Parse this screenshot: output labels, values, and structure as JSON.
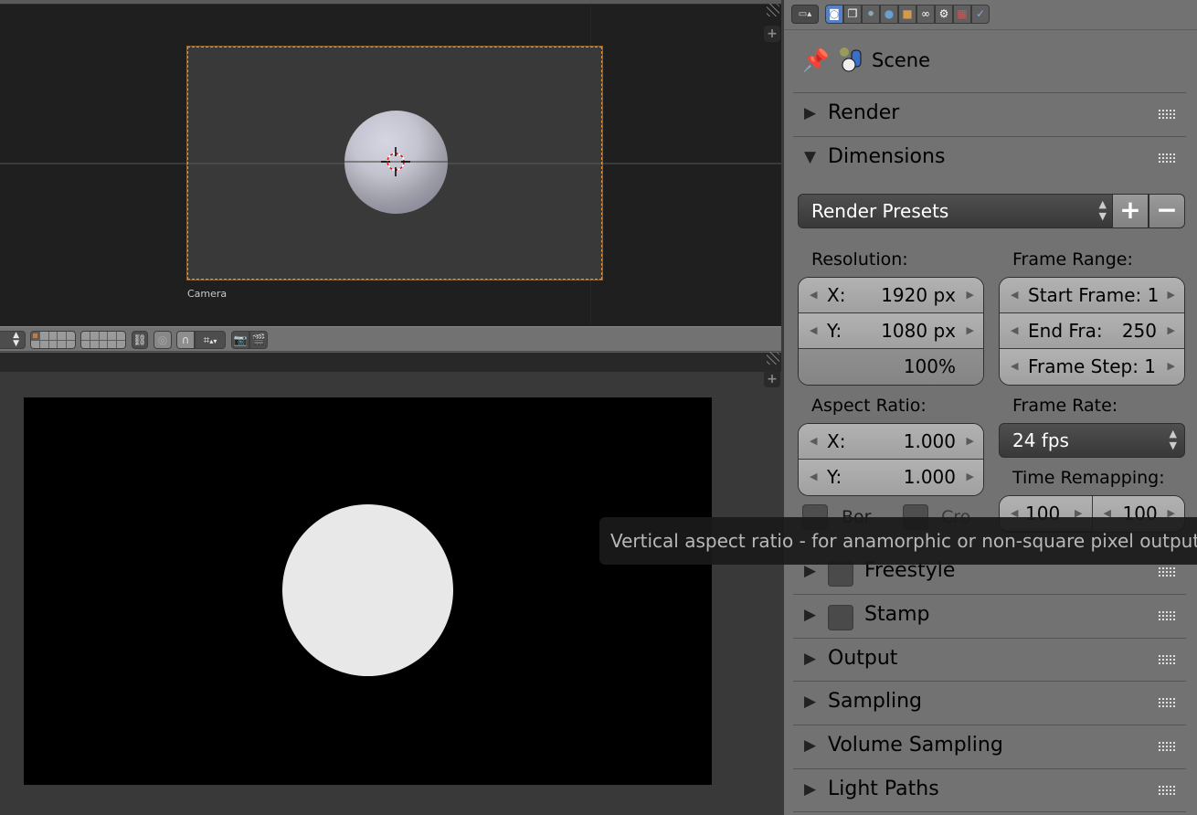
{
  "viewport3d": {
    "camera_label": "Camera",
    "object": "sphere"
  },
  "toolbar3d": {
    "items": [
      {
        "name": "mode-selector",
        "icon": "up-down-arrows"
      },
      {
        "name": "layers-group-1",
        "icon": "layer-grid"
      },
      {
        "name": "layers-group-2",
        "icon": "layer-grid"
      },
      {
        "name": "lock-camera-to-view",
        "icon": "chain-link-icon"
      },
      {
        "name": "proportional-editing",
        "icon": "circle-icon"
      },
      {
        "name": "snap-toggle",
        "icon": "magnet-icon"
      },
      {
        "name": "snap-element",
        "icon": "grid-snap-icon"
      },
      {
        "name": "render-still",
        "icon": "camera-icon"
      },
      {
        "name": "render-animation",
        "icon": "clapper-icon"
      }
    ]
  },
  "properties": {
    "context_tabs": [
      {
        "name": "render",
        "icon": "camera-icon",
        "active": true
      },
      {
        "name": "render-layers",
        "icon": "layers-icon",
        "active": false
      },
      {
        "name": "scene",
        "icon": "scene-icon",
        "active": false
      },
      {
        "name": "world",
        "icon": "globe-icon",
        "active": false
      },
      {
        "name": "object",
        "icon": "cube-icon",
        "active": false
      },
      {
        "name": "constraints",
        "icon": "link-icon",
        "active": false
      },
      {
        "name": "modifiers",
        "icon": "wrench-icon",
        "active": false
      },
      {
        "name": "texture",
        "icon": "checker-icon",
        "active": false
      },
      {
        "name": "particles",
        "icon": "particle-icon",
        "active": false
      }
    ],
    "context_label": "Scene",
    "panels_top": [
      {
        "label": "Render",
        "expanded": false
      },
      {
        "label": "Dimensions",
        "expanded": true
      }
    ],
    "dimensions": {
      "presets_label": "Render Presets",
      "add_symbol": "+",
      "remove_symbol": "−",
      "resolution_label": "Resolution:",
      "res_x_key": "X:",
      "res_x_val": "1920 px",
      "res_y_key": "Y:",
      "res_y_val": "1080 px",
      "res_percent": "100%",
      "frame_range_label": "Frame Range:",
      "start_frame": "Start Frame: 1",
      "end_frame_key": "End Fra:",
      "end_frame_val": "250",
      "frame_step": "Frame Step: 1",
      "aspect_label": "Aspect Ratio:",
      "aspect_x_key": "X:",
      "aspect_x_val": "1.000",
      "aspect_y_key": "Y:",
      "aspect_y_val": "1.000",
      "frame_rate_label": "Frame Rate:",
      "frame_rate_value": "24 fps",
      "time_remap_label": "Time Remapping:",
      "time_remap_old": "100",
      "time_remap_new": "100",
      "border_label": "Bor",
      "crop_label": "Cro"
    },
    "panels_bottom": [
      {
        "label": "Freestyle",
        "checkbox": true
      },
      {
        "label": "Stamp",
        "checkbox": true
      },
      {
        "label": "Output",
        "checkbox": false
      },
      {
        "label": "Sampling",
        "checkbox": false
      },
      {
        "label": "Volume Sampling",
        "checkbox": false
      },
      {
        "label": "Light Paths",
        "checkbox": false
      }
    ]
  },
  "tooltip": {
    "text": "Vertical aspect ratio - for anamorphic or non-square pixel output"
  },
  "colors": {
    "camera_frame": "#e8953a",
    "active_tab": "#5680c2",
    "panel_bg": "#727272",
    "viewport_bg": "#1f1f1f"
  }
}
